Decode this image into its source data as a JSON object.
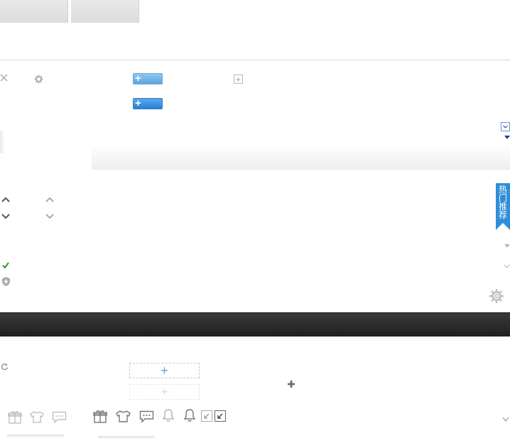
{
  "tabs": {
    "tab1": "",
    "tab2": ""
  },
  "toolbar": {
    "add_button_1": "+",
    "add_button_2": "+",
    "small_add": "+"
  },
  "ribbon": {
    "label": "热门推荐"
  },
  "bottom": {
    "add_slot_1": "+",
    "add_slot_2": "+",
    "plus": "+"
  },
  "icons": {
    "close": "close-icon",
    "settings": "gear-icon",
    "chevron_up": "chevron-up-icon",
    "chevron_down": "chevron-down-icon",
    "check": "check-icon",
    "shield": "shield-icon",
    "refresh": "refresh-icon",
    "gift": "gift-icon",
    "shirt": "shirt-icon",
    "chat": "chat-icon",
    "bell": "bell-icon",
    "shrink": "shrink-icon"
  },
  "colors": {
    "accent_blue": "#2f8ed8",
    "dark_band": "#262626",
    "check_green": "#2a9a2a"
  }
}
